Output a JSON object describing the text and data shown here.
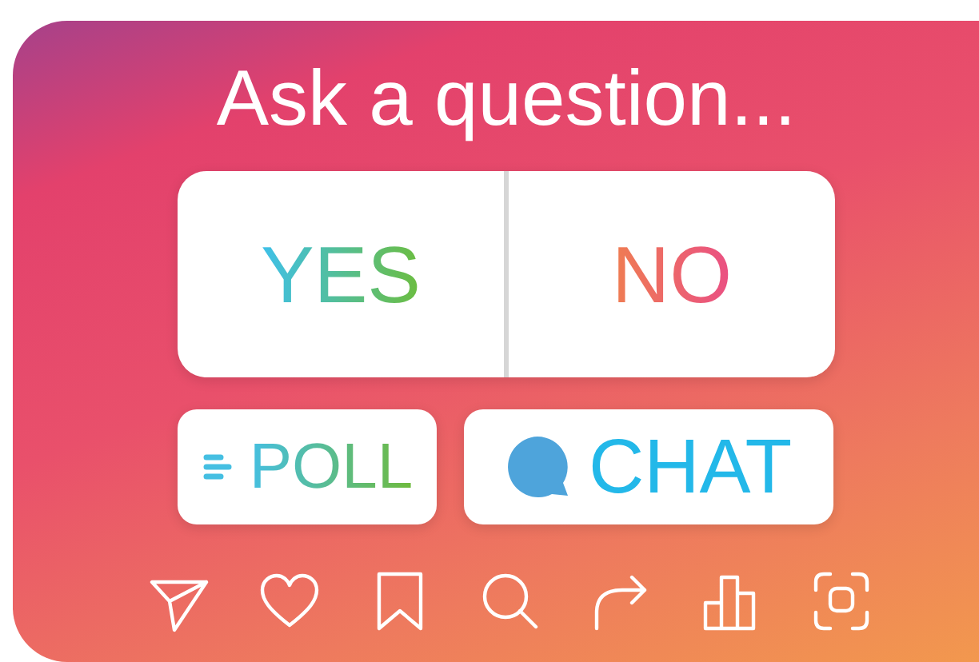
{
  "title": "Ask a question...",
  "vote_options": [
    {
      "label": "YES"
    },
    {
      "label": "NO"
    }
  ],
  "sticker_buttons": [
    {
      "kind": "poll",
      "label": "POLL"
    },
    {
      "kind": "chat",
      "label": "CHAT"
    }
  ]
}
